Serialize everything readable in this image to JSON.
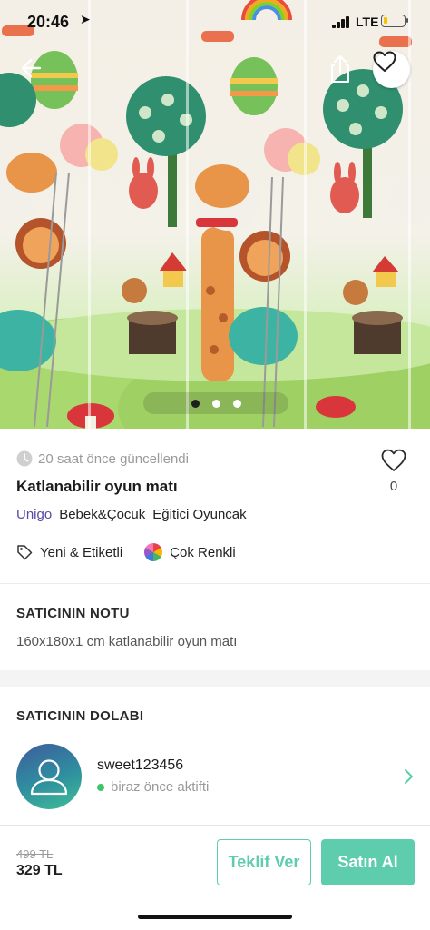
{
  "status_bar": {
    "time": "20:46",
    "network": "LTE"
  },
  "gallery": {
    "page_count": 3,
    "active_index": 0
  },
  "product": {
    "updated": "20 saat önce güncellendi",
    "title": "Katlanabilir oyun matı",
    "like_count": "0",
    "brand": "Unigo",
    "categories": [
      "Bebek&Çocuk",
      "Eğitici Oyuncak"
    ],
    "condition": "Yeni & Etiketli",
    "color": "Çok Renkli"
  },
  "seller_note": {
    "heading": "SATICININ NOTU",
    "text": "160x180x1 cm katlanabilir oyun matı"
  },
  "seller": {
    "heading": "SATICININ DOLABI",
    "username": "sweet123456",
    "status": "biraz önce aktifti"
  },
  "purchase": {
    "old_price": "499 TL",
    "price": "329 TL",
    "offer_label": "Teklif Ver",
    "buy_label": "Satın Al"
  },
  "colors": {
    "accent": "#5ecdad",
    "brand_text": "#5b4aa0",
    "online": "#3fc46a"
  }
}
